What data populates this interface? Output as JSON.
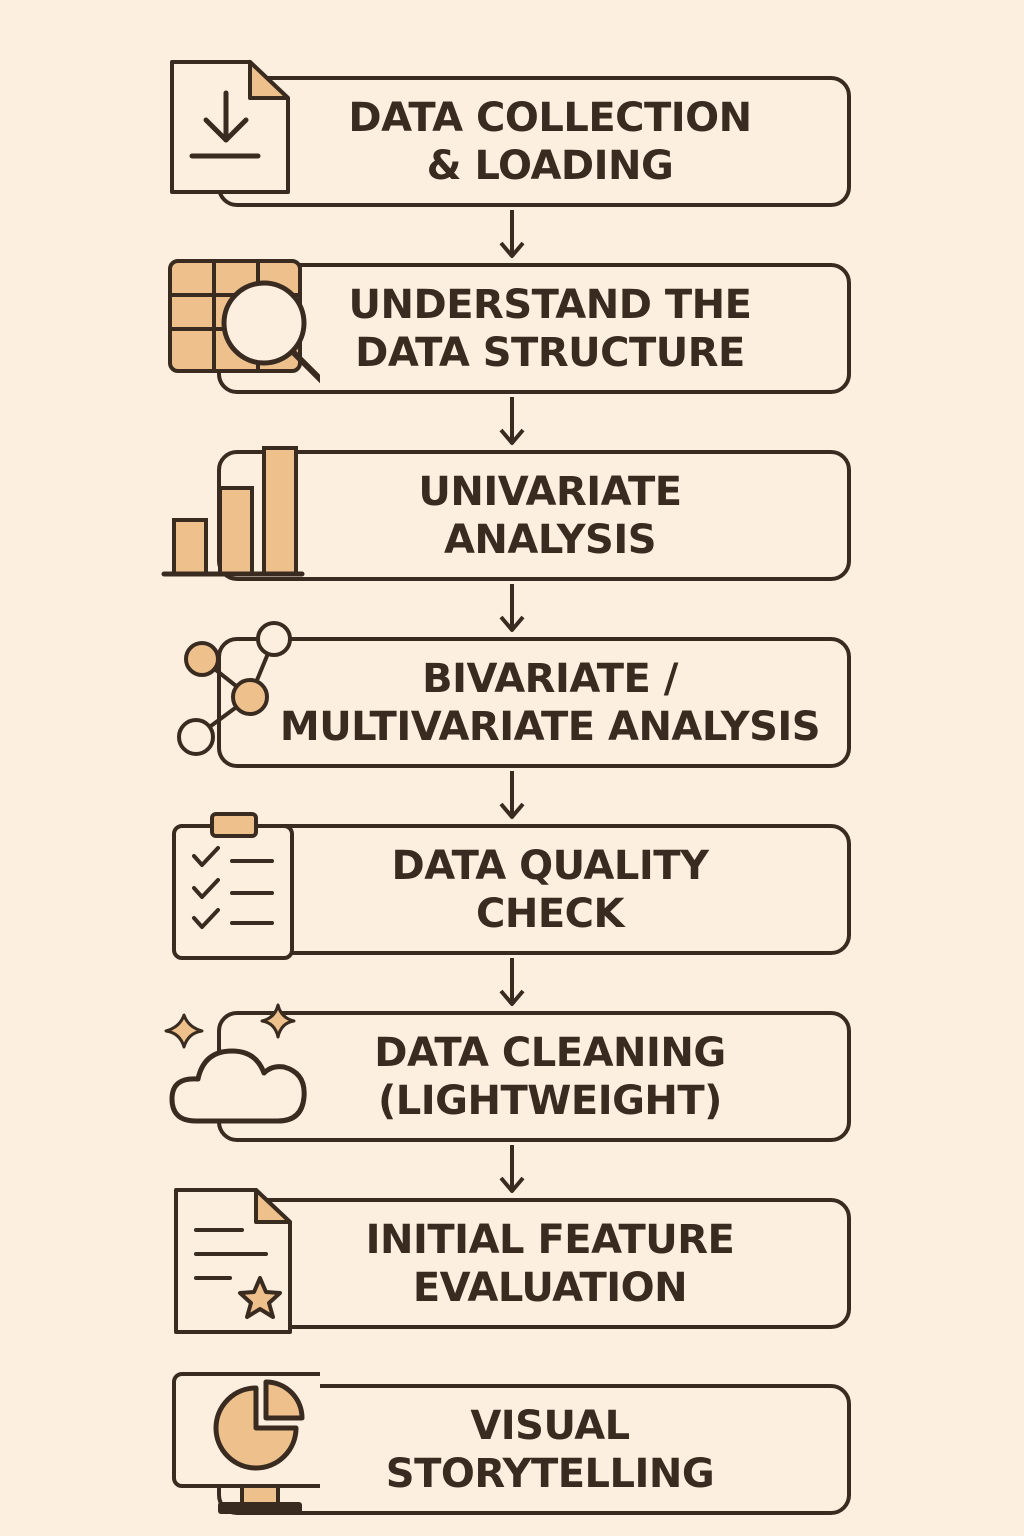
{
  "colors": {
    "background": "#fcefdf",
    "stroke": "#3a2b21",
    "accent": "#eec18c"
  },
  "steps": [
    {
      "label": "DATA COLLECTION\n& LOADING",
      "icon": "download-document-icon"
    },
    {
      "label": "UNDERSTAND THE\nDATA STRUCTURE",
      "icon": "table-magnifier-icon"
    },
    {
      "label": "UNIVARIATE\nANALYSIS",
      "icon": "bar-chart-icon"
    },
    {
      "label": "BIVARIATE /\nMULTIVARIATE ANALYSIS",
      "icon": "network-nodes-icon"
    },
    {
      "label": "DATA QUALITY\nCHECK",
      "icon": "clipboard-checklist-icon"
    },
    {
      "label": "DATA CLEANING\n(LIGHTWEIGHT)",
      "icon": "cloud-sparkles-icon"
    },
    {
      "label": "INITIAL FEATURE\nEVALUATION",
      "icon": "document-star-icon"
    },
    {
      "label": "VISUAL\nSTORYTELLING",
      "icon": "monitor-pie-chart-icon"
    }
  ]
}
